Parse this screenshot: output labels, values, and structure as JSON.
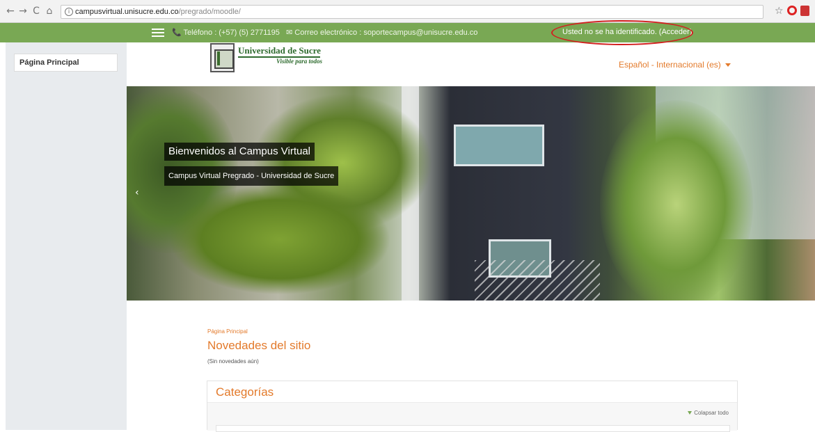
{
  "browser": {
    "url_host": "campusvirtual.unisucre.edu.co",
    "url_path": "/pregrado/moodle/",
    "back_icon": "←",
    "forward_icon": "→",
    "reload_icon": "C",
    "home_icon": "⌂",
    "star_icon": "☆"
  },
  "topbar": {
    "phone": "📞 Teléfono : (+57) (5) 2771195",
    "email": "✉ Correo electrónico : soportecampus@unisucre.edu.co",
    "login_text": "Usted no se ha identificado. (Acceder)",
    "bg_color": "#79a854"
  },
  "sidebar": {
    "items": [
      {
        "label": "Página Principal"
      }
    ]
  },
  "header": {
    "logo_name": "Universidad de Sucre",
    "logo_slogan": "Visible para todos",
    "language": "Español - Internacional (es)"
  },
  "hero": {
    "title": "Bienvenidos al Campus Virtual",
    "subtitle": "Campus Virtual Pregrado - Universidad de Sucre",
    "prev_icon": "‹"
  },
  "main": {
    "breadcrumb": "Página Principal",
    "news_title": "Novedades del sitio",
    "news_empty": "(Sin novedades aún)",
    "categories_title": "Categorías",
    "collapse_label": "Colapsar todo"
  },
  "colors": {
    "accent": "#e37a2b",
    "green": "#79a854",
    "highlight_oval": "#d21f1f"
  }
}
